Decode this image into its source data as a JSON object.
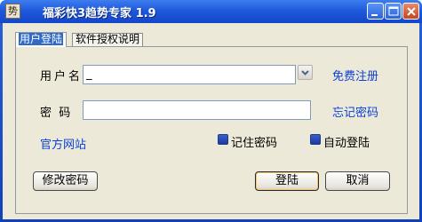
{
  "window": {
    "title": "福彩快3趋势专家 1.9",
    "app_icon": "势"
  },
  "tabs": [
    {
      "label": "用户登陆"
    },
    {
      "label": "软件授权说明"
    }
  ],
  "form": {
    "username_label": "用户名",
    "username_value": "_",
    "password_label": "密  码",
    "password_value": "",
    "register_link": "免费注册",
    "forgot_link": "忘记密码",
    "website_link": "官方网站",
    "remember_label": "记住密码",
    "autologin_label": "自动登陆",
    "remember_checked": true,
    "autologin_checked": true
  },
  "buttons": {
    "change_password": "修改密码",
    "login": "登陆",
    "cancel": "取消"
  },
  "colors": {
    "titlebar": "#1f59dc",
    "link": "#0a3fd8",
    "panel": "#ece9d8"
  }
}
